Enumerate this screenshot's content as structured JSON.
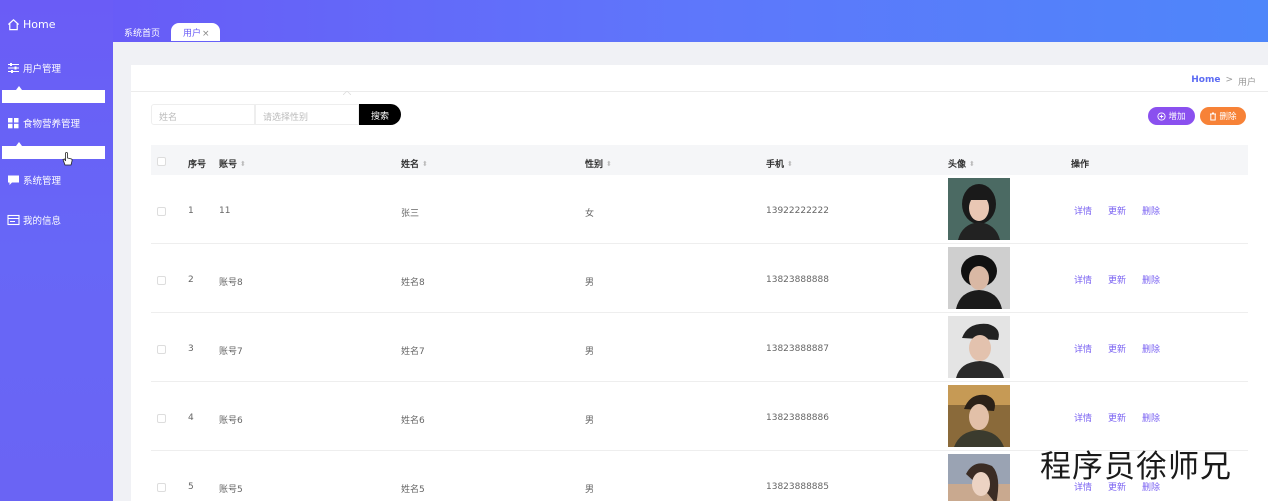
{
  "sidebar": {
    "home_label": "Home",
    "items": [
      {
        "label": "用户管理",
        "icon": "sliders-icon"
      },
      {
        "label": "食物营养管理",
        "icon": "grid-icon"
      },
      {
        "label": "系统管理",
        "icon": "chat-icon"
      },
      {
        "label": "我的信息",
        "icon": "card-icon"
      }
    ]
  },
  "tabs": [
    {
      "label": "系统首页"
    },
    {
      "label": "用户",
      "close": "×"
    }
  ],
  "breadcrumb": {
    "home": "Home",
    "separator": ">",
    "current": "用户"
  },
  "search": {
    "name_placeholder": "姓名",
    "gender_placeholder": "请选择性别",
    "button_label": "搜索"
  },
  "actions": {
    "add_label": "增加",
    "delete_label": "删除"
  },
  "table": {
    "headers": [
      "序号",
      "账号",
      "姓名",
      "性别",
      "手机",
      "头像",
      "操作"
    ],
    "row_actions": [
      "详情",
      "更新",
      "删除"
    ],
    "rows": [
      {
        "index": "1",
        "account": "11",
        "name": "张三",
        "gender": "女",
        "phone": "13922222222"
      },
      {
        "index": "2",
        "account": "账号8",
        "name": "姓名8",
        "gender": "男",
        "phone": "13823888888"
      },
      {
        "index": "3",
        "account": "账号7",
        "name": "姓名7",
        "gender": "男",
        "phone": "13823888887"
      },
      {
        "index": "4",
        "account": "账号6",
        "name": "姓名6",
        "gender": "男",
        "phone": "13823888886"
      },
      {
        "index": "5",
        "account": "账号5",
        "name": "姓名5",
        "gender": "男",
        "phone": "13823888885"
      }
    ]
  },
  "watermark": "程序员徐师兄",
  "colors": {
    "accent": "#6a5cf6",
    "add": "#8a50ef",
    "delete": "#f78237",
    "link": "#7a62f2"
  }
}
